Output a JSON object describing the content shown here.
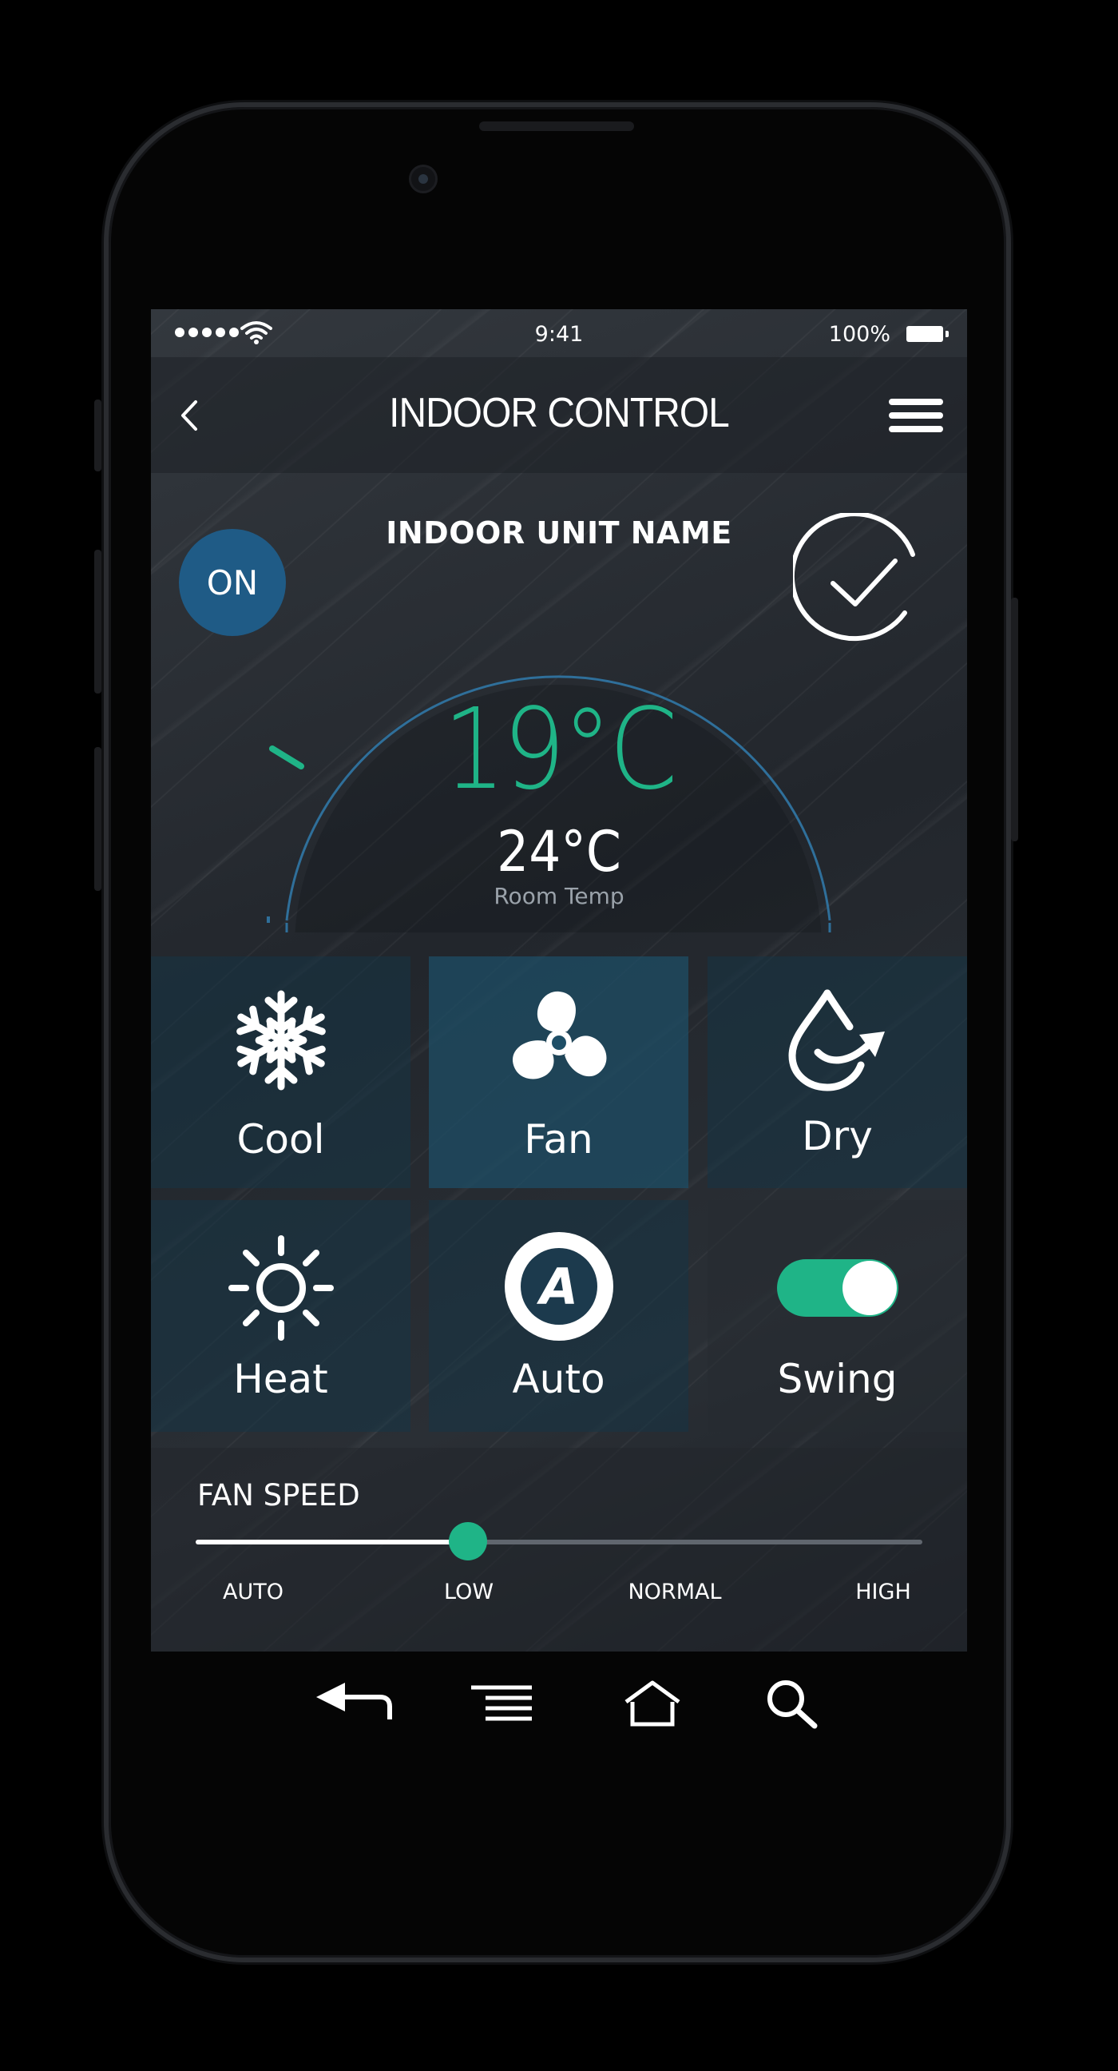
{
  "status_bar": {
    "time": "9:41",
    "battery_percent": "100%",
    "signal_icon": "signal-dots-icon",
    "wifi_icon": "wifi-icon",
    "battery_icon": "battery-icon"
  },
  "nav": {
    "title": "INDOOR CONTROL",
    "back_icon": "chevron-left-icon",
    "menu_icon": "hamburger-menu-icon"
  },
  "unit": {
    "name": "INDOOR UNIT NAME",
    "power_label": "ON",
    "confirm_icon": "checkmark-circle-icon"
  },
  "temperature": {
    "setpoint": "19°C",
    "room_value": "24°C",
    "room_label": "Room Temp"
  },
  "modes": [
    {
      "label": "Cool",
      "icon": "snowflake-icon",
      "active": false
    },
    {
      "label": "Fan",
      "icon": "fan-icon",
      "active": true
    },
    {
      "label": "Dry",
      "icon": "droplet-icon",
      "active": false
    },
    {
      "label": "Heat",
      "icon": "sun-icon",
      "active": false
    },
    {
      "label": "Auto",
      "icon": "auto-a-icon",
      "active": false
    },
    {
      "label": "Swing",
      "icon": "toggle-switch-icon",
      "active": true
    }
  ],
  "fan_speed": {
    "title": "FAN SPEED",
    "levels": [
      "AUTO",
      "LOW",
      "NORMAL",
      "HIGH"
    ],
    "selected": "LOW",
    "value_fraction": 0.375
  },
  "colors": {
    "accent_green": "#1fb487",
    "power_blue": "#1f5b86",
    "active_tile": "#1e4e66"
  },
  "system_nav": {
    "back_icon": "back-arrow-icon",
    "menu_icon": "list-icon",
    "home_icon": "home-icon",
    "search_icon": "search-icon"
  }
}
